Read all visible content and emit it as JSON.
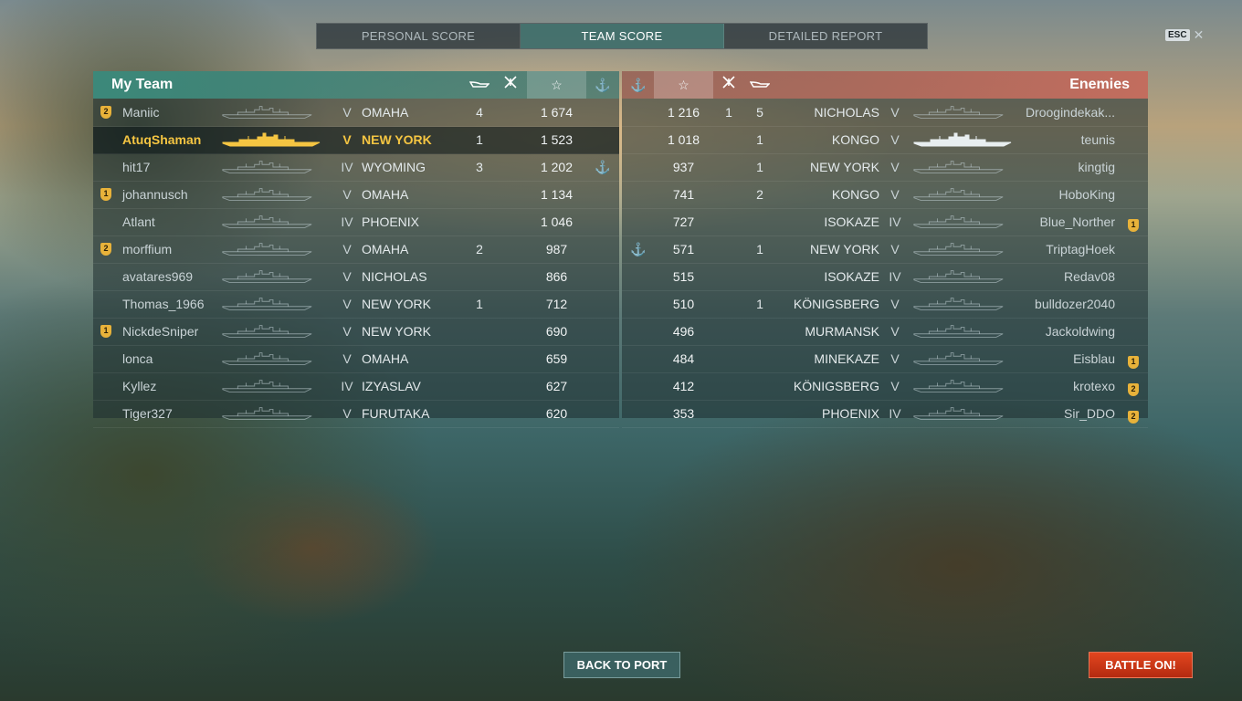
{
  "tabs": [
    {
      "label": "PERSONAL SCORE",
      "active": false
    },
    {
      "label": "TEAM SCORE",
      "active": true
    },
    {
      "label": "DETAILED REPORT",
      "active": false
    }
  ],
  "esc": {
    "key_label": "ESC",
    "close_glyph": "✕"
  },
  "my_team": {
    "title": "My Team",
    "header_icons": [
      "torpedo-icon",
      "plane-icon",
      "star-icon",
      "anchor-icon"
    ],
    "players": [
      {
        "badge": "2",
        "name": "Maniic",
        "tier": "V",
        "ship": "OMAHA",
        "kills": "4",
        "score": "1 674",
        "anchor": "",
        "me": false
      },
      {
        "badge": "",
        "name": "AtuqShaman",
        "tier": "V",
        "ship": "NEW YORK",
        "kills": "1",
        "score": "1 523",
        "anchor": "",
        "me": true
      },
      {
        "badge": "",
        "name": "hit17",
        "tier": "IV",
        "ship": "WYOMING",
        "kills": "3",
        "score": "1 202",
        "anchor": "⚓",
        "me": false
      },
      {
        "badge": "1",
        "name": "johannusch",
        "tier": "V",
        "ship": "OMAHA",
        "kills": "",
        "score": "1 134",
        "anchor": "",
        "me": false
      },
      {
        "badge": "",
        "name": "Atlant",
        "tier": "IV",
        "ship": "PHOENIX",
        "kills": "",
        "score": "1 046",
        "anchor": "",
        "me": false
      },
      {
        "badge": "2",
        "name": "morffium",
        "tier": "V",
        "ship": "OMAHA",
        "kills": "2",
        "score": "987",
        "anchor": "",
        "me": false
      },
      {
        "badge": "",
        "name": "avatares969",
        "tier": "V",
        "ship": "NICHOLAS",
        "kills": "",
        "score": "866",
        "anchor": "",
        "me": false
      },
      {
        "badge": "",
        "name": "Thomas_1966",
        "tier": "V",
        "ship": "NEW YORK",
        "kills": "1",
        "score": "712",
        "anchor": "",
        "me": false
      },
      {
        "badge": "1",
        "name": "NickdeSniper",
        "tier": "V",
        "ship": "NEW YORK",
        "kills": "",
        "score": "690",
        "anchor": "",
        "me": false
      },
      {
        "badge": "",
        "name": "lonca",
        "tier": "V",
        "ship": "OMAHA",
        "kills": "",
        "score": "659",
        "anchor": "",
        "me": false
      },
      {
        "badge": "",
        "name": "Kyllez",
        "tier": "IV",
        "ship": "IZYASLAV",
        "kills": "",
        "score": "627",
        "anchor": "",
        "me": false
      },
      {
        "badge": "",
        "name": "Tiger327",
        "tier": "V",
        "ship": "FURUTAKA",
        "kills": "",
        "score": "620",
        "anchor": "",
        "me": false
      }
    ]
  },
  "enemies": {
    "title": "Enemies",
    "header_icons": [
      "anchor-icon",
      "star-icon",
      "plane-icon",
      "torpedo-icon"
    ],
    "players": [
      {
        "anchor": "",
        "score": "1 216",
        "planes": "1",
        "kills": "5",
        "ship": "NICHOLAS",
        "tier": "V",
        "name": "Droogindekak...",
        "badge": ""
      },
      {
        "anchor": "",
        "score": "1 018",
        "planes": "",
        "kills": "1",
        "ship": "KONGO",
        "tier": "V",
        "name": "teunis",
        "badge": ""
      },
      {
        "anchor": "",
        "score": "937",
        "planes": "",
        "kills": "1",
        "ship": "NEW YORK",
        "tier": "V",
        "name": "kingtig",
        "badge": ""
      },
      {
        "anchor": "",
        "score": "741",
        "planes": "",
        "kills": "2",
        "ship": "KONGO",
        "tier": "V",
        "name": "HoboKing",
        "badge": ""
      },
      {
        "anchor": "",
        "score": "727",
        "planes": "",
        "kills": "",
        "ship": "ISOKAZE",
        "tier": "IV",
        "name": "Blue_Norther",
        "badge": "1"
      },
      {
        "anchor": "⚓",
        "score": "571",
        "planes": "",
        "kills": "1",
        "ship": "NEW YORK",
        "tier": "V",
        "name": "TriptagHoek",
        "badge": ""
      },
      {
        "anchor": "",
        "score": "515",
        "planes": "",
        "kills": "",
        "ship": "ISOKAZE",
        "tier": "IV",
        "name": "Redav08",
        "badge": ""
      },
      {
        "anchor": "",
        "score": "510",
        "planes": "",
        "kills": "1",
        "ship": "KÖNIGSBERG",
        "tier": "V",
        "name": "bulldozer2040",
        "badge": ""
      },
      {
        "anchor": "",
        "score": "496",
        "planes": "",
        "kills": "",
        "ship": "MURMANSK",
        "tier": "V",
        "name": "Jackoldwing",
        "badge": ""
      },
      {
        "anchor": "",
        "score": "484",
        "planes": "",
        "kills": "",
        "ship": "MINEKAZE",
        "tier": "V",
        "name": "Eisblau",
        "badge": "1"
      },
      {
        "anchor": "",
        "score": "412",
        "planes": "",
        "kills": "",
        "ship": "KÖNIGSBERG",
        "tier": "V",
        "name": "krotexo",
        "badge": "2"
      },
      {
        "anchor": "",
        "score": "353",
        "planes": "",
        "kills": "",
        "ship": "PHOENIX",
        "tier": "IV",
        "name": "Sir_DDO",
        "badge": "2"
      }
    ]
  },
  "buttons": {
    "back": "BACK TO PORT",
    "battle": "BATTLE ON!"
  },
  "colors": {
    "accent_green": "#3c8c7d",
    "accent_red": "#c86e5f",
    "highlight_yellow": "#f5c542",
    "battle_button": "#d13a18"
  }
}
